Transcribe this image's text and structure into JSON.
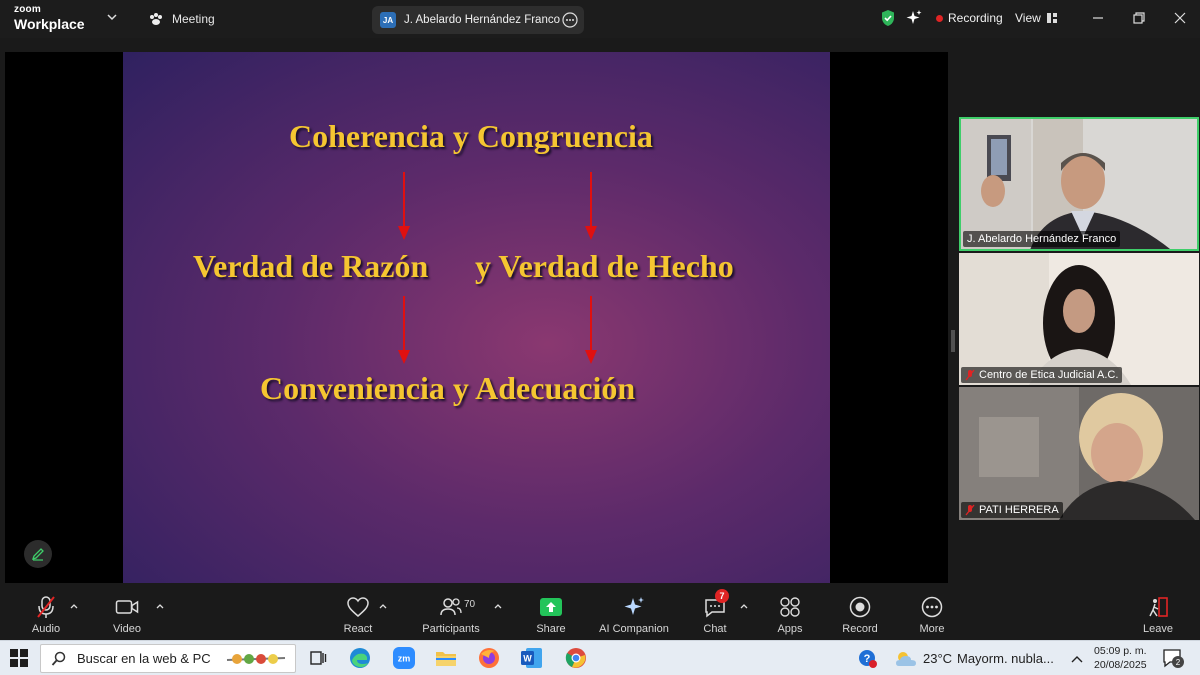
{
  "titlebar": {
    "brand_top": "zoom",
    "brand_bottom": "Workplace",
    "meeting_tab": "Meeting",
    "share_tab_initials": "JA",
    "share_tab_label": "J. Abelardo Hernández Franco's sc",
    "recording_label": "Recording",
    "view_label": "View"
  },
  "slide": {
    "line1": "Coherencia y Congruencia",
    "line2a": "Verdad de Razón",
    "line2b": "y Verdad de Hecho",
    "line3": "Conveniencia y Adecuación"
  },
  "gallery": [
    {
      "name": "J. Abelardo Hernández Franco",
      "muted": false
    },
    {
      "name": "Centro de Etica Judicial A.C.",
      "muted": true
    },
    {
      "name": "PATI HERRERA",
      "muted": true
    }
  ],
  "toolbar": {
    "audio": "Audio",
    "video": "Video",
    "react": "React",
    "participants": "Participants",
    "participants_count": "70",
    "share": "Share",
    "ai_companion": "AI Companion",
    "chat": "Chat",
    "chat_badge": "7",
    "apps": "Apps",
    "record": "Record",
    "more": "More",
    "leave": "Leave"
  },
  "taskbar": {
    "search_placeholder": "Buscar en la web & PC",
    "weather_temp": "23°C",
    "weather_text": "Mayorm. nubla...",
    "time": "05:09 p. m.",
    "date": "20/08/2025",
    "notifications": "2"
  },
  "colors": {
    "slide_text": "#f5c631",
    "arrow": "#e01010",
    "speaker_border": "#3fce6a",
    "share_green": "#23c45a",
    "recording_dot": "#e02424"
  }
}
